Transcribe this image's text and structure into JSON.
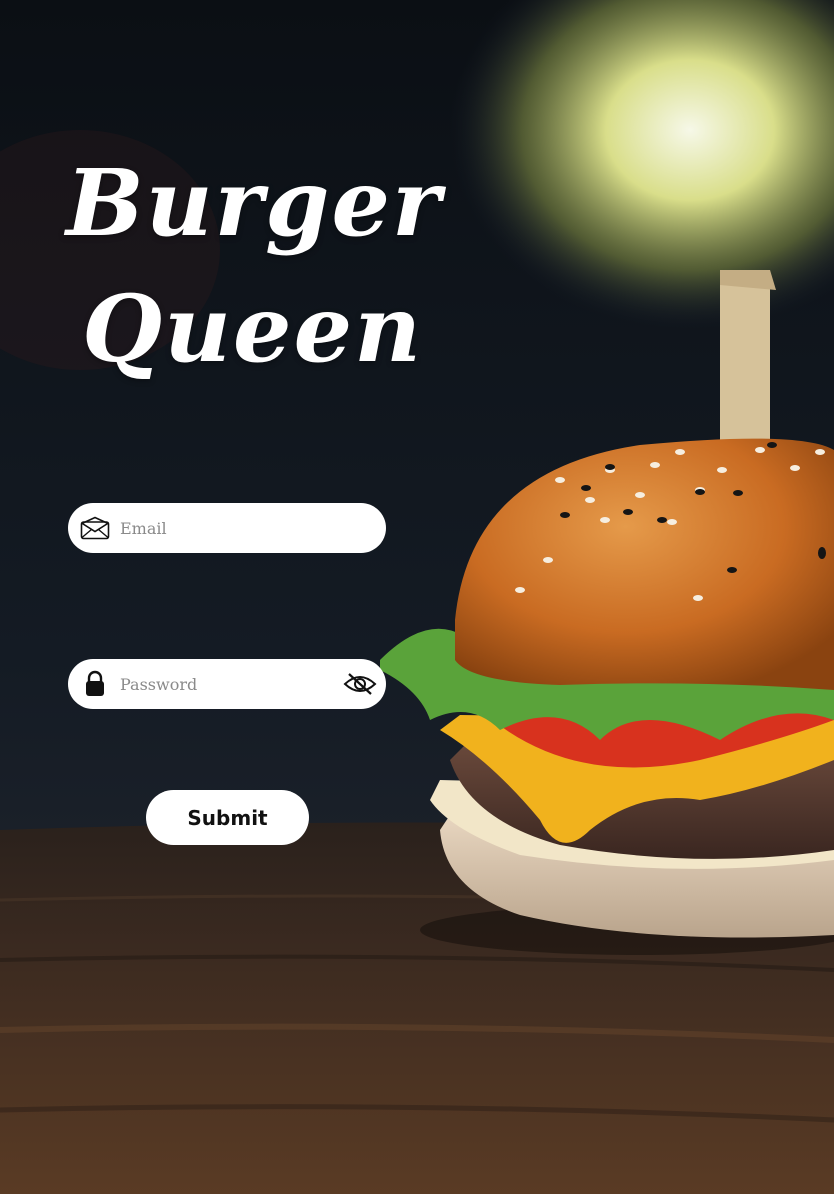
{
  "brand": {
    "title_line1": "Burger",
    "title_line2": "Queen"
  },
  "form": {
    "email": {
      "placeholder": "Email",
      "value": "",
      "icon": "envelope-icon"
    },
    "password": {
      "placeholder": "Password",
      "value": "",
      "icon": "lock-icon",
      "toggle_icon": "eye-off-icon"
    },
    "submit_label": "Submit"
  },
  "colors": {
    "field_bg": "#ffffff",
    "text_white": "#ffffff",
    "button_text": "#111111"
  }
}
